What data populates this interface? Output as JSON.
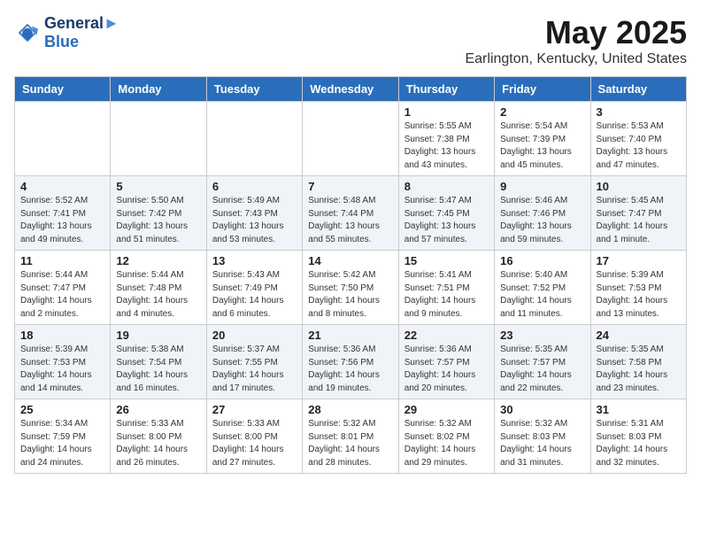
{
  "header": {
    "logo_line1": "General",
    "logo_line2": "Blue",
    "month": "May 2025",
    "location": "Earlington, Kentucky, United States"
  },
  "weekdays": [
    "Sunday",
    "Monday",
    "Tuesday",
    "Wednesday",
    "Thursday",
    "Friday",
    "Saturday"
  ],
  "weeks": [
    [
      {
        "day": "",
        "info": ""
      },
      {
        "day": "",
        "info": ""
      },
      {
        "day": "",
        "info": ""
      },
      {
        "day": "",
        "info": ""
      },
      {
        "day": "1",
        "info": "Sunrise: 5:55 AM\nSunset: 7:38 PM\nDaylight: 13 hours\nand 43 minutes."
      },
      {
        "day": "2",
        "info": "Sunrise: 5:54 AM\nSunset: 7:39 PM\nDaylight: 13 hours\nand 45 minutes."
      },
      {
        "day": "3",
        "info": "Sunrise: 5:53 AM\nSunset: 7:40 PM\nDaylight: 13 hours\nand 47 minutes."
      }
    ],
    [
      {
        "day": "4",
        "info": "Sunrise: 5:52 AM\nSunset: 7:41 PM\nDaylight: 13 hours\nand 49 minutes."
      },
      {
        "day": "5",
        "info": "Sunrise: 5:50 AM\nSunset: 7:42 PM\nDaylight: 13 hours\nand 51 minutes."
      },
      {
        "day": "6",
        "info": "Sunrise: 5:49 AM\nSunset: 7:43 PM\nDaylight: 13 hours\nand 53 minutes."
      },
      {
        "day": "7",
        "info": "Sunrise: 5:48 AM\nSunset: 7:44 PM\nDaylight: 13 hours\nand 55 minutes."
      },
      {
        "day": "8",
        "info": "Sunrise: 5:47 AM\nSunset: 7:45 PM\nDaylight: 13 hours\nand 57 minutes."
      },
      {
        "day": "9",
        "info": "Sunrise: 5:46 AM\nSunset: 7:46 PM\nDaylight: 13 hours\nand 59 minutes."
      },
      {
        "day": "10",
        "info": "Sunrise: 5:45 AM\nSunset: 7:47 PM\nDaylight: 14 hours\nand 1 minute."
      }
    ],
    [
      {
        "day": "11",
        "info": "Sunrise: 5:44 AM\nSunset: 7:47 PM\nDaylight: 14 hours\nand 2 minutes."
      },
      {
        "day": "12",
        "info": "Sunrise: 5:44 AM\nSunset: 7:48 PM\nDaylight: 14 hours\nand 4 minutes."
      },
      {
        "day": "13",
        "info": "Sunrise: 5:43 AM\nSunset: 7:49 PM\nDaylight: 14 hours\nand 6 minutes."
      },
      {
        "day": "14",
        "info": "Sunrise: 5:42 AM\nSunset: 7:50 PM\nDaylight: 14 hours\nand 8 minutes."
      },
      {
        "day": "15",
        "info": "Sunrise: 5:41 AM\nSunset: 7:51 PM\nDaylight: 14 hours\nand 9 minutes."
      },
      {
        "day": "16",
        "info": "Sunrise: 5:40 AM\nSunset: 7:52 PM\nDaylight: 14 hours\nand 11 minutes."
      },
      {
        "day": "17",
        "info": "Sunrise: 5:39 AM\nSunset: 7:53 PM\nDaylight: 14 hours\nand 13 minutes."
      }
    ],
    [
      {
        "day": "18",
        "info": "Sunrise: 5:39 AM\nSunset: 7:53 PM\nDaylight: 14 hours\nand 14 minutes."
      },
      {
        "day": "19",
        "info": "Sunrise: 5:38 AM\nSunset: 7:54 PM\nDaylight: 14 hours\nand 16 minutes."
      },
      {
        "day": "20",
        "info": "Sunrise: 5:37 AM\nSunset: 7:55 PM\nDaylight: 14 hours\nand 17 minutes."
      },
      {
        "day": "21",
        "info": "Sunrise: 5:36 AM\nSunset: 7:56 PM\nDaylight: 14 hours\nand 19 minutes."
      },
      {
        "day": "22",
        "info": "Sunrise: 5:36 AM\nSunset: 7:57 PM\nDaylight: 14 hours\nand 20 minutes."
      },
      {
        "day": "23",
        "info": "Sunrise: 5:35 AM\nSunset: 7:57 PM\nDaylight: 14 hours\nand 22 minutes."
      },
      {
        "day": "24",
        "info": "Sunrise: 5:35 AM\nSunset: 7:58 PM\nDaylight: 14 hours\nand 23 minutes."
      }
    ],
    [
      {
        "day": "25",
        "info": "Sunrise: 5:34 AM\nSunset: 7:59 PM\nDaylight: 14 hours\nand 24 minutes."
      },
      {
        "day": "26",
        "info": "Sunrise: 5:33 AM\nSunset: 8:00 PM\nDaylight: 14 hours\nand 26 minutes."
      },
      {
        "day": "27",
        "info": "Sunrise: 5:33 AM\nSunset: 8:00 PM\nDaylight: 14 hours\nand 27 minutes."
      },
      {
        "day": "28",
        "info": "Sunrise: 5:32 AM\nSunset: 8:01 PM\nDaylight: 14 hours\nand 28 minutes."
      },
      {
        "day": "29",
        "info": "Sunrise: 5:32 AM\nSunset: 8:02 PM\nDaylight: 14 hours\nand 29 minutes."
      },
      {
        "day": "30",
        "info": "Sunrise: 5:32 AM\nSunset: 8:03 PM\nDaylight: 14 hours\nand 31 minutes."
      },
      {
        "day": "31",
        "info": "Sunrise: 5:31 AM\nSunset: 8:03 PM\nDaylight: 14 hours\nand 32 minutes."
      }
    ]
  ]
}
